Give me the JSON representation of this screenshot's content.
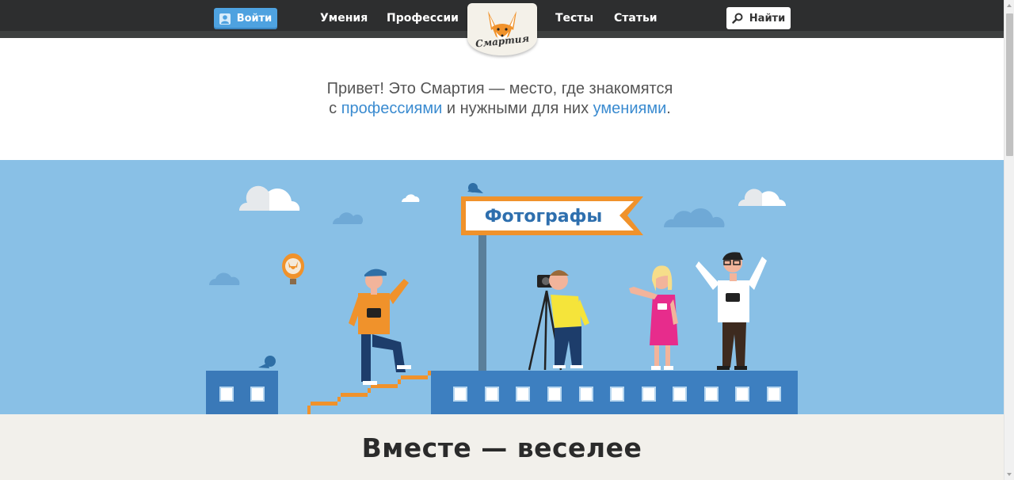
{
  "nav": {
    "login_label": "Войти",
    "links": [
      "Умения",
      "Профессии",
      "Тесты",
      "Статьи"
    ],
    "search_label": "Найти",
    "logo_text": "Смартия"
  },
  "intro": {
    "line1": "Привет! Это Смартия — место, где знакомятся",
    "line2_prefix": "с ",
    "professions_link": "профессиями",
    "line2_middle": " и нужными для них ",
    "skills_link": "умениями",
    "line2_suffix": "."
  },
  "hero": {
    "sign_text": "Фотографы"
  },
  "section": {
    "title": "Вместе — веселее"
  },
  "colors": {
    "topbar": "#2d2e2f",
    "login_button": "#4ea2e0",
    "link": "#3a8bd0",
    "sky": "#89c0e6",
    "building": "#3d7fc0",
    "stairs": "#f0922b",
    "bottom_bg": "#f2f0eb"
  }
}
